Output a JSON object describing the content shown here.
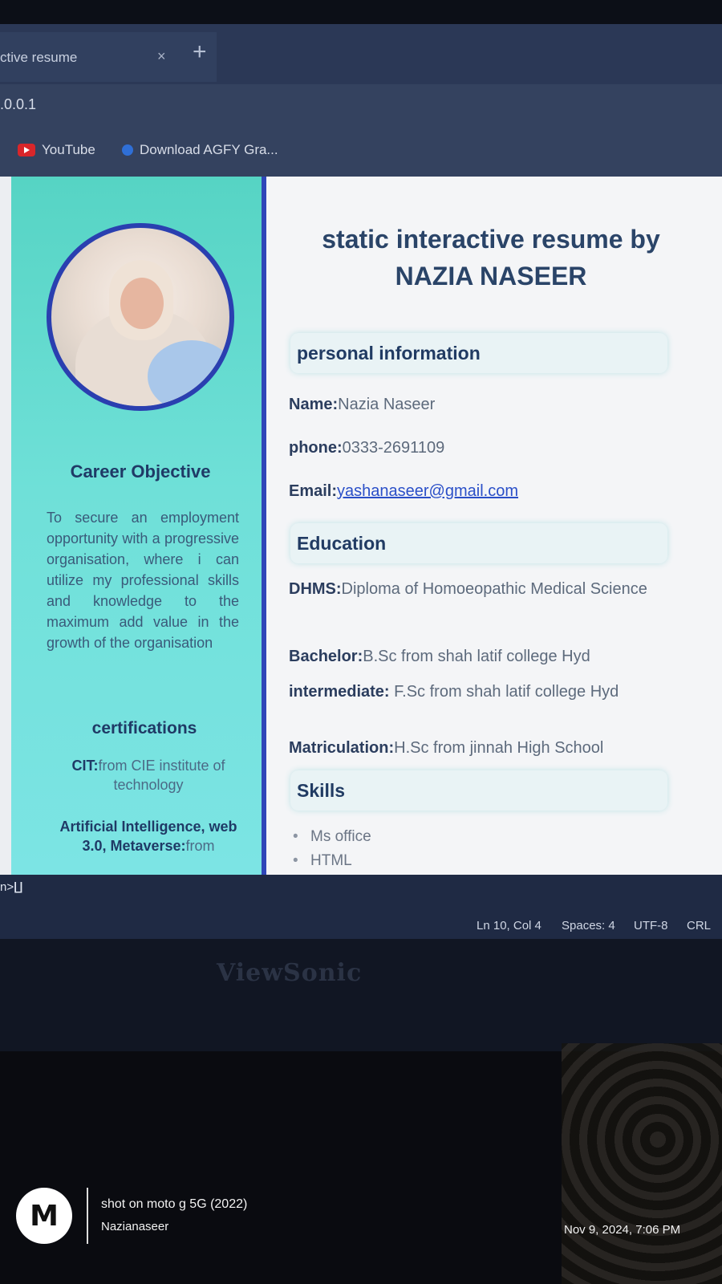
{
  "browser": {
    "tab_title": "ctive resume",
    "tab_close": "×",
    "new_tab": "+",
    "address": ".0.0.1",
    "bookmarks": [
      {
        "label": "YouTube",
        "icon": "youtube-icon"
      },
      {
        "label": "Download AGFY Gra...",
        "icon": "download-icon"
      }
    ]
  },
  "sidebar": {
    "career_title": "Career Objective",
    "career_text": "To secure an employment opportunity with a progressive organisation, where i can utilize my professional skills and knowledge to the maximum add value in the growth of the organisation",
    "cert_title": "certifications",
    "certs": [
      {
        "label": "CIT:",
        "text": "from CIE institute of technology"
      },
      {
        "label": "Artificial Intelligence, web 3.0, Metaverse:",
        "text": "from"
      }
    ]
  },
  "main": {
    "title": "static interactive resume by NAZIA NASEER",
    "personal_title": "personal information",
    "name_label": "Name:",
    "name_value": "Nazia Naseer",
    "phone_label": "phone:",
    "phone_value": "0333-2691109",
    "email_label": "Email:",
    "email_value": "yashanaseer@gmail.com",
    "education_title": "Education",
    "education": [
      {
        "label": "DHMS:",
        "text": "Diploma of Homoeopathic Medical Science"
      },
      {
        "label": "Bachelor:",
        "text": "B.Sc from shah latif college Hyd"
      },
      {
        "label": "intermediate:",
        "text": " F.Sc from shah latif college Hyd"
      },
      {
        "label": "Matriculation:",
        "text": "H.Sc from jinnah High School"
      }
    ],
    "skills_title": "Skills",
    "skills": [
      "Ms office",
      "HTML"
    ]
  },
  "statusbar": {
    "left": "n>∐",
    "position": "Ln 10, Col 4",
    "spaces": "Spaces: 4",
    "encoding": "UTF-8",
    "eol": "CRL"
  },
  "monitor_brand": "ViewSonic",
  "watermark": {
    "shot": "shot on moto g 5G (2022)",
    "user": "Nazianaseer",
    "date": "Nov 9, 2024, 7:06 PM"
  }
}
